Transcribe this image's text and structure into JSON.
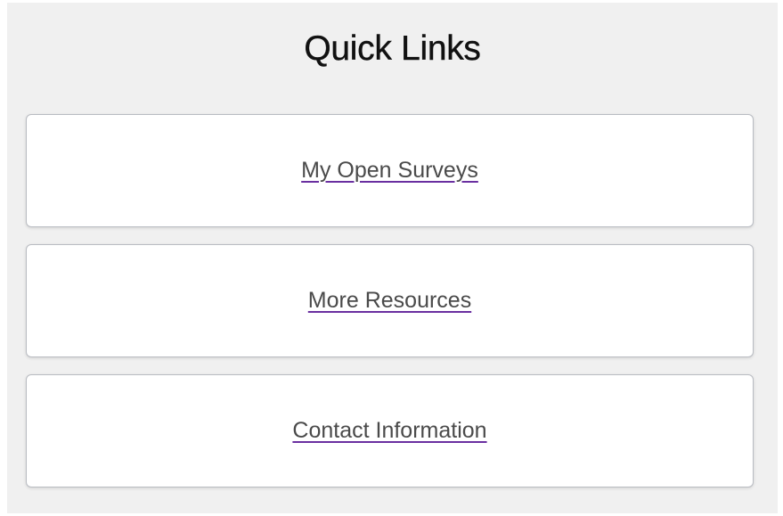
{
  "quick_links": {
    "title": "Quick Links",
    "links": [
      {
        "label": "My Open Surveys"
      },
      {
        "label": "More Resources"
      },
      {
        "label": "Contact Information"
      }
    ]
  },
  "colors": {
    "panel_background": "#f0f0f0",
    "card_background": "#ffffff",
    "card_border": "#b9bcc2",
    "link_text": "#4a4a4a",
    "link_underline": "#6a2fa0"
  }
}
